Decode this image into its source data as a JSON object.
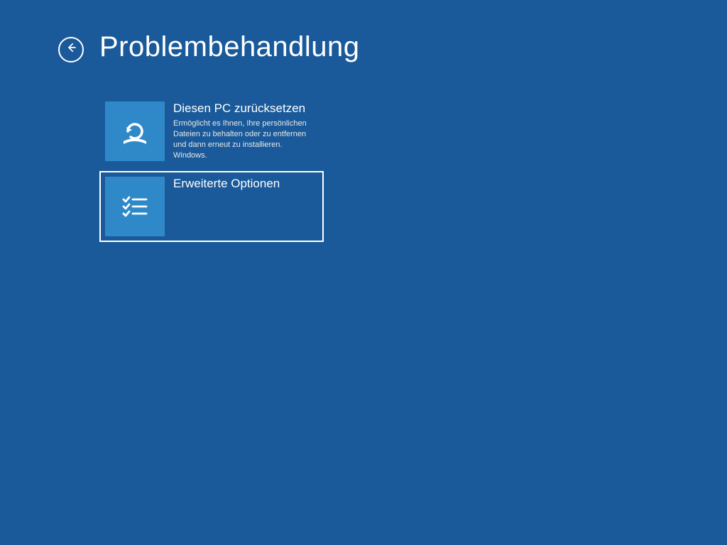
{
  "header": {
    "title": "Problembehandlung"
  },
  "options": {
    "reset": {
      "title": "Diesen PC zurücksetzen",
      "description": "Ermöglicht es Ihnen, Ihre persönlichen Dateien zu behalten oder zu entfernen und dann erneut zu installieren. Windows."
    },
    "advanced": {
      "title": "Erweiterte Optionen"
    }
  },
  "colors": {
    "background": "#1a5a9a",
    "tile": "#2f89c9"
  }
}
